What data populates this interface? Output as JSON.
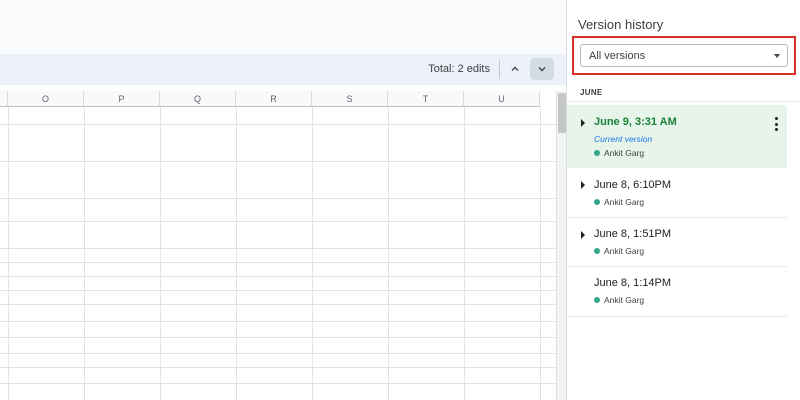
{
  "edits": {
    "total_label": "Total: 2 edits"
  },
  "columns": [
    "O",
    "P",
    "Q",
    "R",
    "S",
    "T",
    "U"
  ],
  "version_history": {
    "title": "Version history",
    "filter": {
      "selected": "All versions"
    },
    "groups": [
      {
        "month": "JUNE",
        "versions": [
          {
            "date": "June 9, 3:31 AM",
            "subtitle": "Current version",
            "author": "Ankit Garg",
            "expandable": true,
            "current": true
          },
          {
            "date": "June 8, 6:10PM",
            "subtitle": "",
            "author": "Ankit Garg",
            "expandable": true,
            "current": false
          },
          {
            "date": "June 8, 1:51PM",
            "subtitle": "",
            "author": "Ankit Garg",
            "expandable": true,
            "current": false
          },
          {
            "date": "June 8, 1:14PM",
            "subtitle": "",
            "author": "Ankit Garg",
            "expandable": false,
            "current": false
          }
        ]
      }
    ]
  },
  "icons": {
    "prev_edit": "chevron-up-icon",
    "next_edit": "chevron-down-icon",
    "filter_dropdown": "caret-down-icon",
    "expand": "caret-right-icon",
    "more": "more-vert-icon",
    "author_dot": "user-color-dot-icon"
  },
  "colors": {
    "current_version_bg": "#e6f4ea",
    "current_version_text": "#188038",
    "current_version_label": "#1a73e8",
    "author_dot": "#33a58a",
    "highlight_outline": "#d93025"
  }
}
